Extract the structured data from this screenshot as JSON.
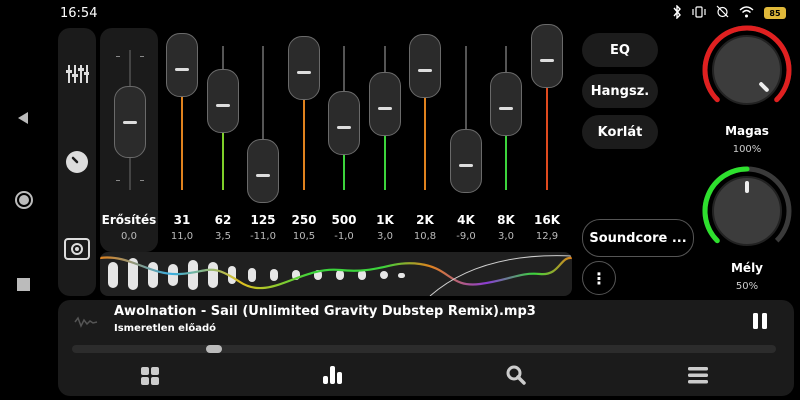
{
  "status": {
    "time": "16:54",
    "battery": "85"
  },
  "gain": {
    "label": "Erősítés",
    "value": "0,0"
  },
  "bands": [
    {
      "freq": "31",
      "value": "11,0",
      "level": 11.0,
      "color": "#e0821e"
    },
    {
      "freq": "62",
      "value": "3,5",
      "level": 3.5,
      "color": "#7ecf2a"
    },
    {
      "freq": "125",
      "value": "-11,0",
      "level": -11.0,
      "color": "#e0821e"
    },
    {
      "freq": "250",
      "value": "10,5",
      "level": 10.5,
      "color": "#e0821e"
    },
    {
      "freq": "500",
      "value": "-1,0",
      "level": -1.0,
      "color": "#3cd43c"
    },
    {
      "freq": "1K",
      "value": "3,0",
      "level": 3.0,
      "color": "#3cd43c"
    },
    {
      "freq": "2K",
      "value": "10,8",
      "level": 10.8,
      "color": "#e0821e"
    },
    {
      "freq": "4K",
      "value": "-9,0",
      "level": -9.0,
      "color": "#3aaee0"
    },
    {
      "freq": "8K",
      "value": "3,0",
      "level": 3.0,
      "color": "#3cd43c"
    },
    {
      "freq": "16K",
      "value": "12,9",
      "level": 12.9,
      "color": "#e04a1e"
    }
  ],
  "buttons": {
    "eq": "EQ",
    "hangsz": "Hangsz.",
    "korlat": "Korlát",
    "device": "Soundcore ...",
    "more": "⋮"
  },
  "knobs": {
    "high": {
      "label": "Magas",
      "value": "100%",
      "level": 1.0,
      "color": "#e02020"
    },
    "low": {
      "label": "Mély",
      "value": "50%",
      "level": 0.5,
      "color": "#2ee02e"
    }
  },
  "player": {
    "title": "Awolnation - Sail (Unlimited Gravity Dubstep Remix).mp3",
    "artist": "Ismeretlen előadó",
    "progress": 0.19
  },
  "icons": {
    "back": "back-triangle-icon",
    "home": "home-circle-icon",
    "recents": "recents-square-icon",
    "sliders": "sliders-icon",
    "knob": "knob-icon",
    "surround": "surround-icon",
    "pause": "pause-icon",
    "grid": "grid-icon",
    "bars": "bars-icon",
    "search": "search-icon",
    "menu": "menu-icon"
  }
}
